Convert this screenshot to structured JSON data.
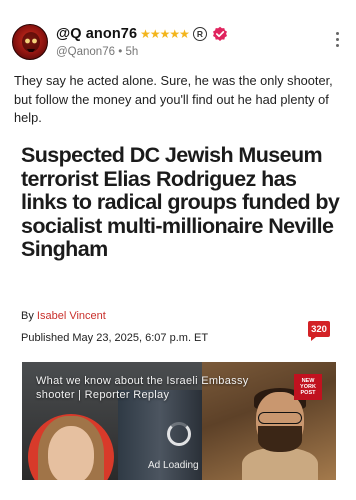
{
  "post": {
    "display_name": "@Q anon76",
    "stars": "★★★★★",
    "registered_mark": "R",
    "handle": "@Qanon76",
    "separator": "•",
    "age": "5h",
    "text": "They say he acted alone. Sure, he was the only shooter, but follow the money and you'll find out he had plenty of help."
  },
  "article": {
    "headline": "Suspected DC Jewish Museum terrorist Elias Rodriguez has links to radical groups funded by socialist multi-millionaire Neville Singham",
    "by_prefix": "By",
    "author": "Isabel Vincent",
    "published": "Published May 23, 2025, 6:07 p.m. ET",
    "comment_count": "320"
  },
  "video": {
    "title": "What we know about the Israeli Embassy shooter | Reporter Replay",
    "logo_text": "NEW YORK POST",
    "status": "Ad Loading"
  },
  "colors": {
    "author_link": "#c9302c",
    "comment_badge": "#d32226",
    "star": "#f3b51d",
    "verified": "#e0245e"
  },
  "icons": {
    "avatar": "red-skull-avatar",
    "verified": "verified-badge-icon",
    "more": "more-vertical-icon",
    "spinner": "loading-spinner-icon"
  }
}
